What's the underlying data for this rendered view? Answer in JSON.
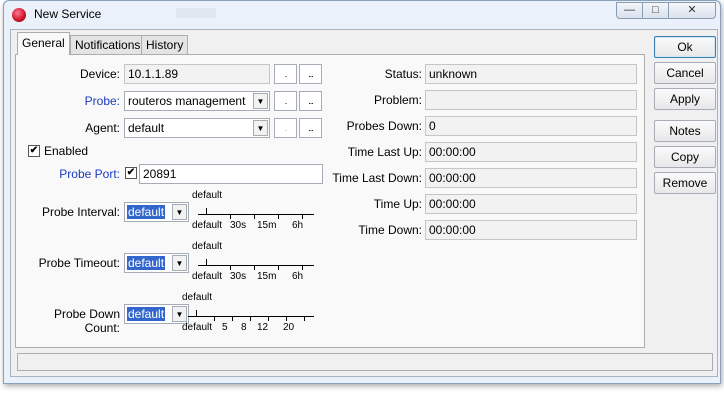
{
  "window": {
    "title": "New Service"
  },
  "tabs": [
    "General",
    "Notifications",
    "History"
  ],
  "buttons": [
    "Ok",
    "Cancel",
    "Apply",
    "Notes",
    "Copy",
    "Remove"
  ],
  "left": {
    "device_label": "Device:",
    "device_value": "10.1.1.89",
    "probe_label": "Probe:",
    "probe_value": "routeros management",
    "agent_label": "Agent:",
    "agent_value": "default",
    "enabled_label": "Enabled",
    "enabled_checked": true,
    "probe_port_label": "Probe Port:",
    "probe_port_value": "20891",
    "probe_port_checked": true,
    "more_glyph": "...",
    "dot_glyph": ".",
    "check_glyph": "✔",
    "arrow_glyph": "▼"
  },
  "sliders": [
    {
      "label": "Probe Interval:",
      "value": "default",
      "top_label": "default",
      "ticks": [
        "default",
        "30s",
        "15m",
        "6h"
      ]
    },
    {
      "label": "Probe Timeout:",
      "value": "default",
      "top_label": "default",
      "ticks": [
        "default",
        "30s",
        "15m",
        "6h"
      ]
    },
    {
      "label": "Probe Down Count:",
      "value": "default",
      "top_label": "default",
      "ticks": [
        "default",
        "5",
        "8",
        "12",
        "20"
      ]
    }
  ],
  "right": {
    "status_label": "Status:",
    "status_value": "unknown",
    "problem_label": "Problem:",
    "problem_value": "",
    "probes_down_label": "Probes Down:",
    "probes_down_value": "0",
    "time_last_up_label": "Time Last Up:",
    "time_last_up_value": "00:00:00",
    "time_last_down_label": "Time Last Down:",
    "time_last_down_value": "00:00:00",
    "time_up_label": "Time Up:",
    "time_up_value": "00:00:00",
    "time_down_label": "Time Down:",
    "time_down_value": "00:00:00"
  }
}
